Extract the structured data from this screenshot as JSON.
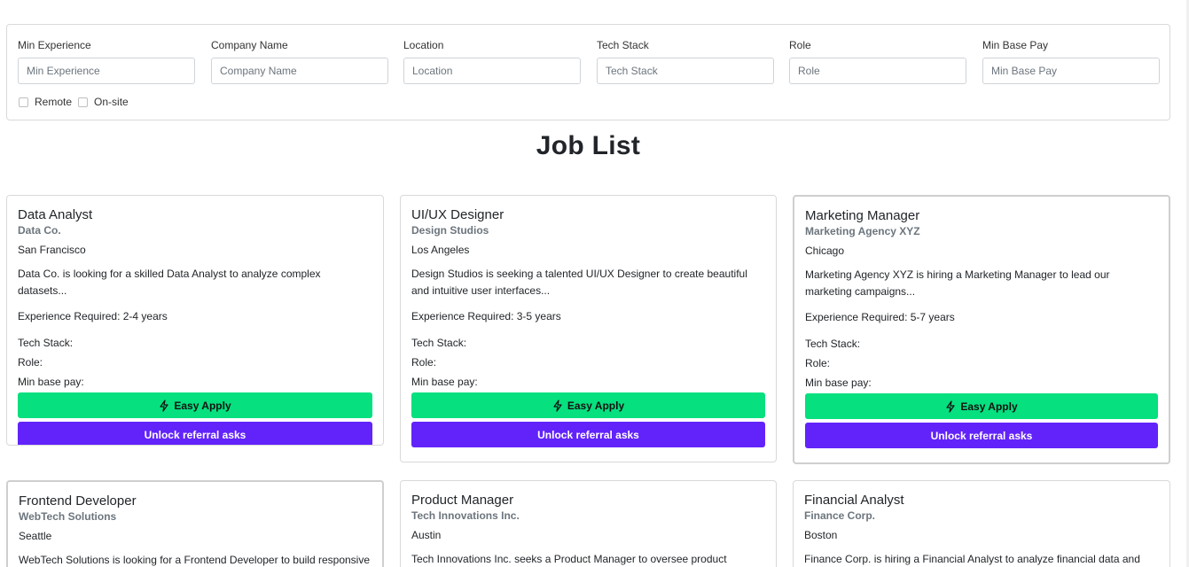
{
  "filters": {
    "min_experience": {
      "label": "Min Experience",
      "placeholder": "Min Experience"
    },
    "company_name": {
      "label": "Company Name",
      "placeholder": "Company Name"
    },
    "location": {
      "label": "Location",
      "placeholder": "Location"
    },
    "tech_stack": {
      "label": "Tech Stack",
      "placeholder": "Tech Stack"
    },
    "role": {
      "label": "Role",
      "placeholder": "Role"
    },
    "min_base_pay": {
      "label": "Min Base Pay",
      "placeholder": "Min Base Pay"
    },
    "remote_label": "Remote",
    "onsite_label": "On-site"
  },
  "page_title": "Job List",
  "labels": {
    "tech_stack": "Tech Stack:",
    "role": "Role:",
    "min_base_pay": "Min base pay:",
    "easy_apply": "Easy Apply",
    "unlock_referral": "Unlock referral asks",
    "easy_apply_icon": "lightning-bolt-icon"
  },
  "colors": {
    "easy_apply_bg": "#06e07f",
    "referral_bg": "#6223fb"
  },
  "jobs": [
    {
      "title": "Data Analyst",
      "company": "Data Co.",
      "location": "San Francisco",
      "description": "Data Co. is looking for a skilled Data Analyst to analyze complex datasets...",
      "experience": "Experience Required: 2-4 years"
    },
    {
      "title": "UI/UX Designer",
      "company": "Design Studios",
      "location": "Los Angeles",
      "description": "Design Studios is seeking a talented UI/UX Designer to create beautiful and intuitive user interfaces...",
      "experience": "Experience Required: 3-5 years"
    },
    {
      "title": "Marketing Manager",
      "company": "Marketing Agency XYZ",
      "location": "Chicago",
      "description": "Marketing Agency XYZ is hiring a Marketing Manager to lead our marketing campaigns...",
      "experience": "Experience Required: 5-7 years"
    },
    {
      "title": "Frontend Developer",
      "company": "WebTech Solutions",
      "location": "Seattle",
      "description": "WebTech Solutions is looking for a Frontend Developer to build responsive"
    },
    {
      "title": "Product Manager",
      "company": "Tech Innovations Inc.",
      "location": "Austin",
      "description": "Tech Innovations Inc. seeks a Product Manager to oversee product"
    },
    {
      "title": "Financial Analyst",
      "company": "Finance Corp.",
      "location": "Boston",
      "description": "Finance Corp. is hiring a Financial Analyst to analyze financial data and"
    }
  ]
}
